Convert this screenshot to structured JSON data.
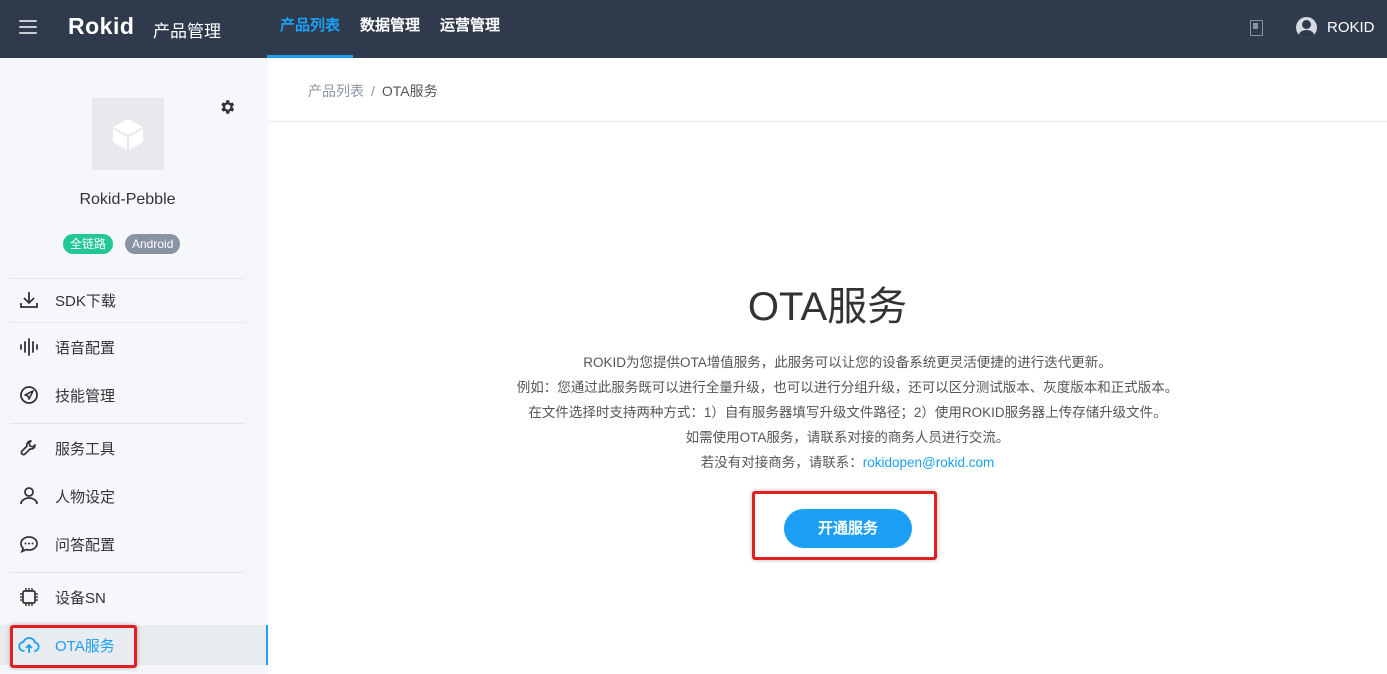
{
  "header": {
    "logo": "Rokid",
    "product_title": "产品管理",
    "tabs": [
      {
        "label": "产品列表",
        "active": true
      },
      {
        "label": "数据管理",
        "active": false
      },
      {
        "label": "运营管理",
        "active": false
      }
    ],
    "username": "ROKID"
  },
  "sidebar": {
    "product_name": "Rokid-Pebble",
    "tags": [
      "全链路",
      "Android"
    ],
    "items": [
      {
        "label": "SDK下载",
        "icon": "download-icon"
      },
      {
        "label": "语音配置",
        "icon": "waveform-icon"
      },
      {
        "label": "技能管理",
        "icon": "compass-icon"
      },
      {
        "label": "服务工具",
        "icon": "wrench-icon"
      },
      {
        "label": "人物设定",
        "icon": "person-icon"
      },
      {
        "label": "问答配置",
        "icon": "chat-icon"
      },
      {
        "label": "设备SN",
        "icon": "chip-icon"
      },
      {
        "label": "OTA服务",
        "icon": "cloud-icon",
        "active": true
      }
    ]
  },
  "breadcrumb": {
    "parent": "产品列表",
    "separator": "/",
    "current": "OTA服务"
  },
  "main": {
    "title": "OTA服务",
    "lines": [
      "ROKID为您提供OTA增值服务，此服务可以让您的设备系统更灵活便捷的进行迭代更新。",
      "例如：您通过此服务既可以进行全量升级，也可以进行分组升级，还可以区分测试版本、灰度版本和正式版本。",
      "在文件选择时支持两种方式：1）自有服务器填写升级文件路径；2）使用ROKID服务器上传存储升级文件。",
      "如需使用OTA服务，请联系对接的商务人员进行交流。"
    ],
    "contact_prefix": "若没有对接商务，请联系：",
    "contact_email": "rokidopen@rokid.com",
    "button_label": "开通服务"
  },
  "colors": {
    "topbar": "#2f3a4d",
    "accent": "#1ba0f5",
    "tag_green": "#21c896",
    "tag_gray": "#8a93a3",
    "highlight": "#e02020"
  }
}
